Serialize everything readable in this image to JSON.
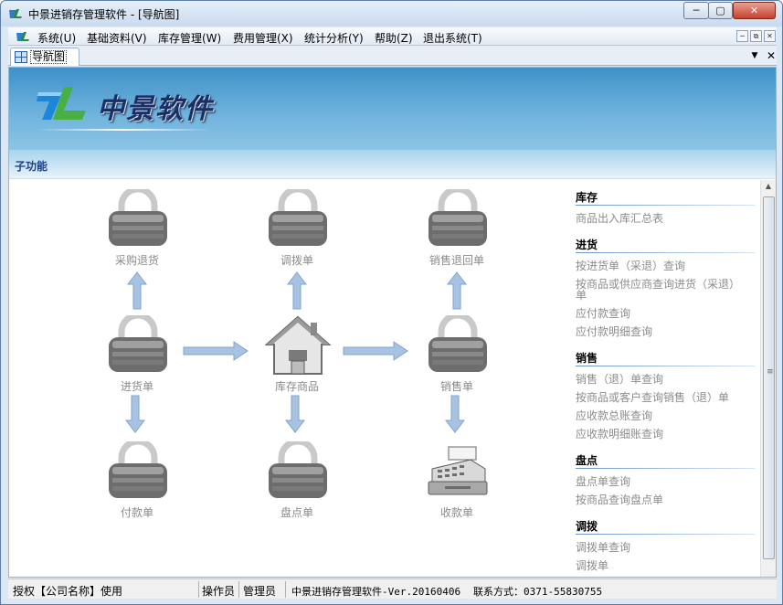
{
  "window": {
    "title": "中景进销存管理软件 - [导航图]",
    "minimize": "─",
    "maximize": "▢",
    "close": "✕"
  },
  "menubar": {
    "items": [
      {
        "label": "系统(U)"
      },
      {
        "label": "基础资料(V)"
      },
      {
        "label": "库存管理(W)"
      },
      {
        "label": "费用管理(X)"
      },
      {
        "label": "统计分析(Y)"
      },
      {
        "label": "帮助(Z)"
      },
      {
        "label": "退出系统(T)"
      }
    ],
    "mdi_min": "─",
    "mdi_restore": "⧉",
    "mdi_close": "✕"
  },
  "tabbar": {
    "tab_label": "导航图",
    "dropdown": "▼",
    "close": "✕"
  },
  "banner": {
    "title": "中景软件"
  },
  "section_header": "子功能",
  "flow": {
    "nodes": [
      {
        "label": "采购退货",
        "icon": "padlock-icon"
      },
      {
        "label": "调拨单",
        "icon": "padlock-icon"
      },
      {
        "label": "销售退回单",
        "icon": "padlock-icon"
      },
      {
        "label": "进货单",
        "icon": "padlock-icon"
      },
      {
        "label": "库存商品",
        "icon": "house-icon"
      },
      {
        "label": "销售单",
        "icon": "padlock-icon"
      },
      {
        "label": "付款单",
        "icon": "padlock-icon"
      },
      {
        "label": "盘点单",
        "icon": "padlock-icon"
      },
      {
        "label": "收款单",
        "icon": "cash-register-icon"
      }
    ]
  },
  "right_panel": {
    "sections": [
      {
        "title": "库存",
        "items": [
          "商品出入库汇总表"
        ]
      },
      {
        "title": "进货",
        "items": [
          "按进货单（采退）查询",
          "按商品或供应商查询进货（采退）单",
          "应付款查询",
          "应付款明细查询"
        ]
      },
      {
        "title": "销售",
        "items": [
          "销售（退）单查询",
          "按商品或客户查询销售（退）单",
          "应收款总账查询",
          "应收款明细账查询"
        ]
      },
      {
        "title": "盘点",
        "items": [
          "盘点单查询",
          "按商品查询盘点单"
        ]
      },
      {
        "title": "调拨",
        "items": [
          "调拨单查询",
          "调拨单"
        ]
      }
    ]
  },
  "statusbar": {
    "license": "授权【公司名称】使用",
    "operator_label": "操作员",
    "operator": "管理员",
    "version": "中景进销存管理软件-Ver.20160406",
    "contact": "联系方式：0371-55830755"
  },
  "colors": {
    "banner_top": "#3e91c9",
    "banner_bottom": "#8cc5e6",
    "title_text": "#1b2f66",
    "section_header": "#1d3f8a",
    "arrow_fill": "#a8c3e2",
    "disabled_text": "#8c8c8c"
  }
}
